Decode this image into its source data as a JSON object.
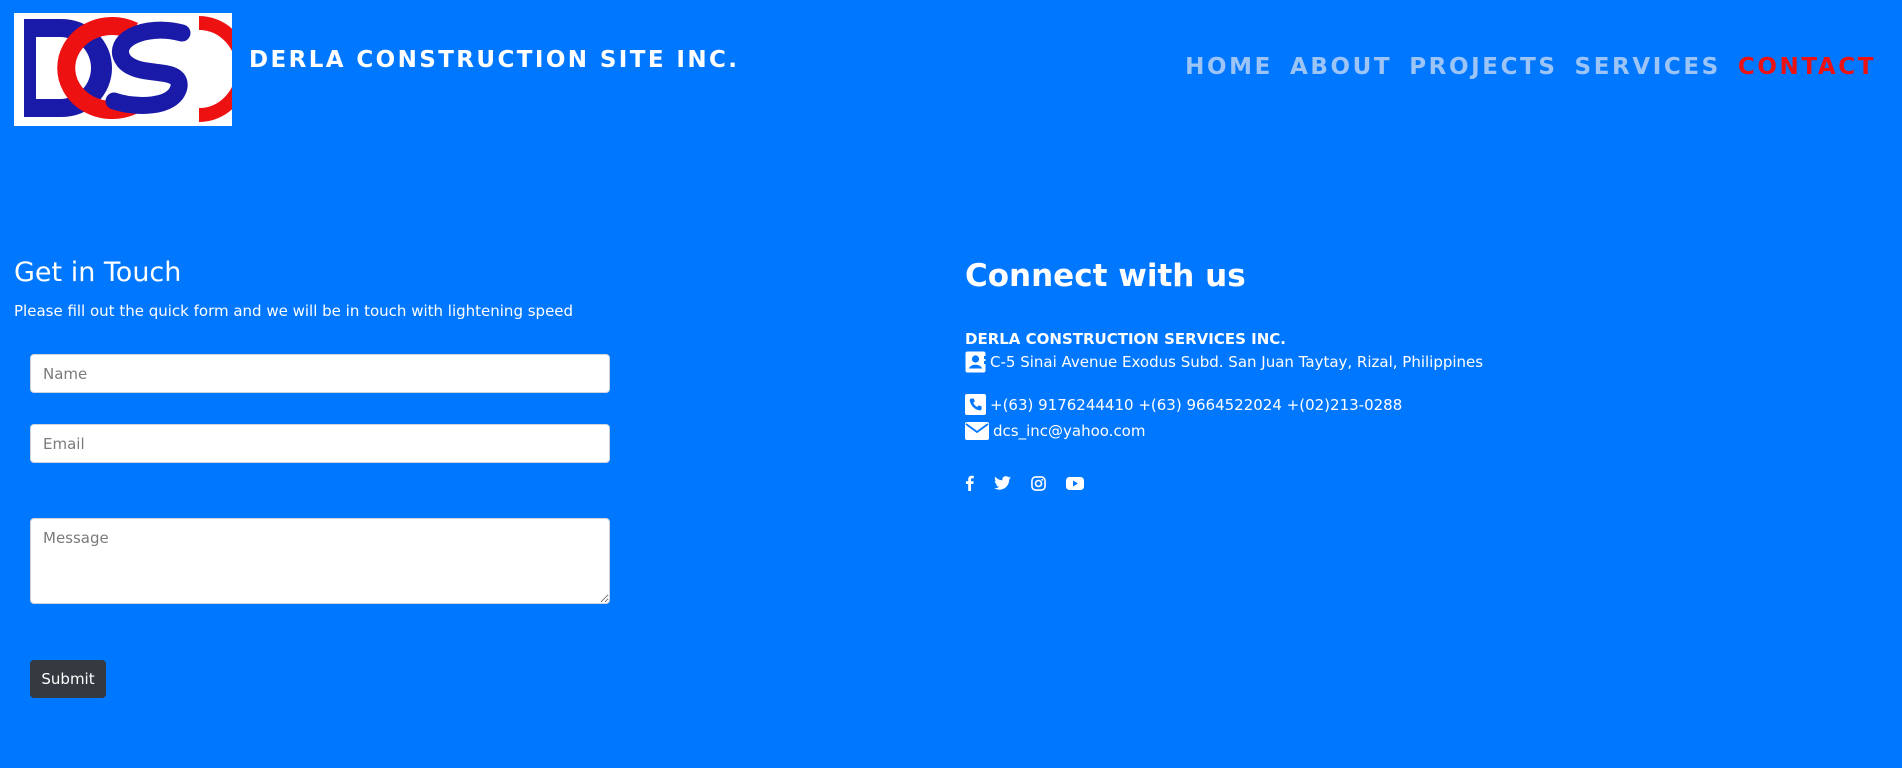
{
  "header": {
    "logo_text": "DCS",
    "brand": "DERLA CONSTRUCTION SITE INC.",
    "nav": [
      {
        "label": "HOME",
        "active": false
      },
      {
        "label": "ABOUT",
        "active": false
      },
      {
        "label": "PROJECTS",
        "active": false
      },
      {
        "label": "SERVICES",
        "active": false
      },
      {
        "label": "CONTACT",
        "active": true
      }
    ]
  },
  "contact_form": {
    "title": "Get in Touch",
    "subtitle": "Please fill out the quick form and we will be in touch with lightening speed",
    "name_placeholder": "Name",
    "email_placeholder": "Email",
    "message_placeholder": "Message",
    "submit_label": "Submit"
  },
  "connect": {
    "title": "Connect with us",
    "company": "DERLA CONSTRUCTION SERVICES INC.",
    "address": "C-5 Sinai Avenue Exodus Subd. San Juan Taytay, Rizal, Philippines",
    "phones": "+(63) 9176244410 +(63) 9664522024 +(02)213-0288",
    "email": "dcs_inc@yahoo.com",
    "social_icons": [
      "facebook-icon",
      "twitter-icon",
      "instagram-icon",
      "youtube-icon"
    ]
  },
  "colors": {
    "background": "#0077ff",
    "nav_inactive": "#9dc4f7",
    "nav_active": "#ee1111",
    "logo_blue": "#1a1aa8",
    "logo_red": "#ee1111",
    "button_dark": "#343a40"
  }
}
